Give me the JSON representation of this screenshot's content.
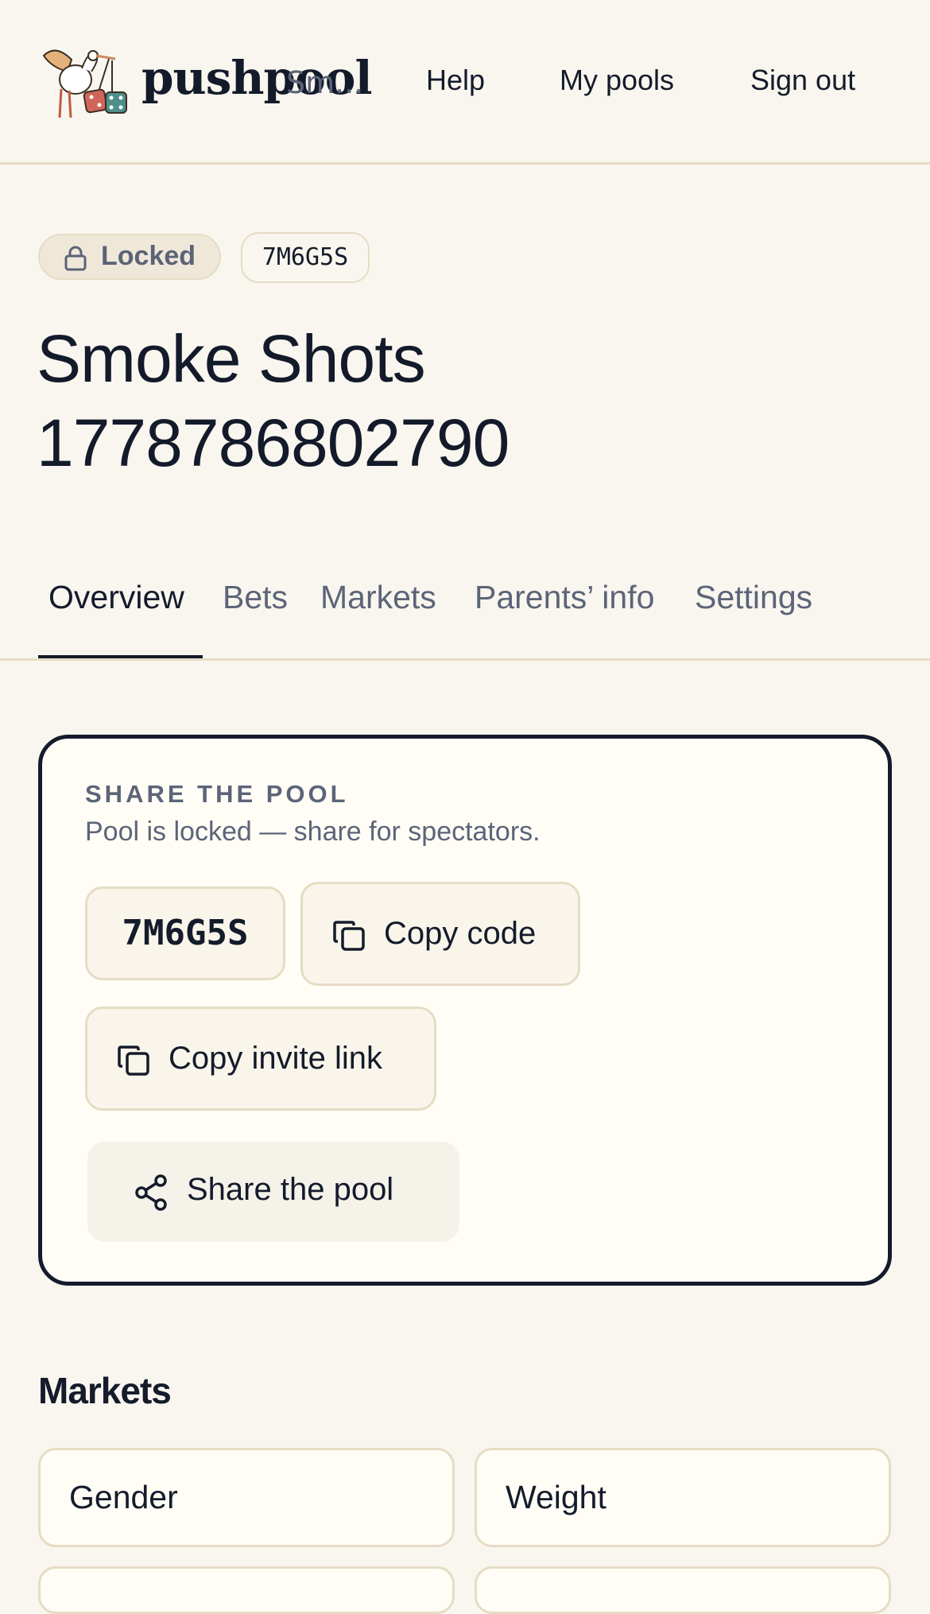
{
  "header": {
    "brand": "pushpool",
    "brand_overflow": "Sm...",
    "nav": {
      "help": "Help",
      "my_pools": "My pools",
      "sign_out": "Sign out"
    }
  },
  "pool": {
    "status": "Locked",
    "code": "7M6G5S",
    "title": "Smoke Shots 1778786802790"
  },
  "tabs": [
    {
      "label": "Overview",
      "active": true
    },
    {
      "label": "Bets"
    },
    {
      "label": "Markets"
    },
    {
      "label": "Parents’ info"
    },
    {
      "label": "Settings"
    }
  ],
  "share": {
    "heading": "SHARE THE POOL",
    "subtitle": "Pool is locked — share for spectators.",
    "code": "7M6G5S",
    "copy_code": "Copy code",
    "copy_invite_link": "Copy invite link",
    "share_the_pool": "Share the pool"
  },
  "markets": {
    "heading": "Markets",
    "items": [
      {
        "label": "Gender"
      },
      {
        "label": "Weight"
      },
      {
        "label": ""
      },
      {
        "label": ""
      }
    ]
  },
  "colors": {
    "background": "#f9f6ef",
    "text": "#141b2b",
    "muted": "#5c6478",
    "border": "#e6dcc4",
    "card": "#fffdf6"
  },
  "icons": [
    "stork-dice-logo",
    "lock-icon",
    "copy-icon",
    "share-icon"
  ]
}
